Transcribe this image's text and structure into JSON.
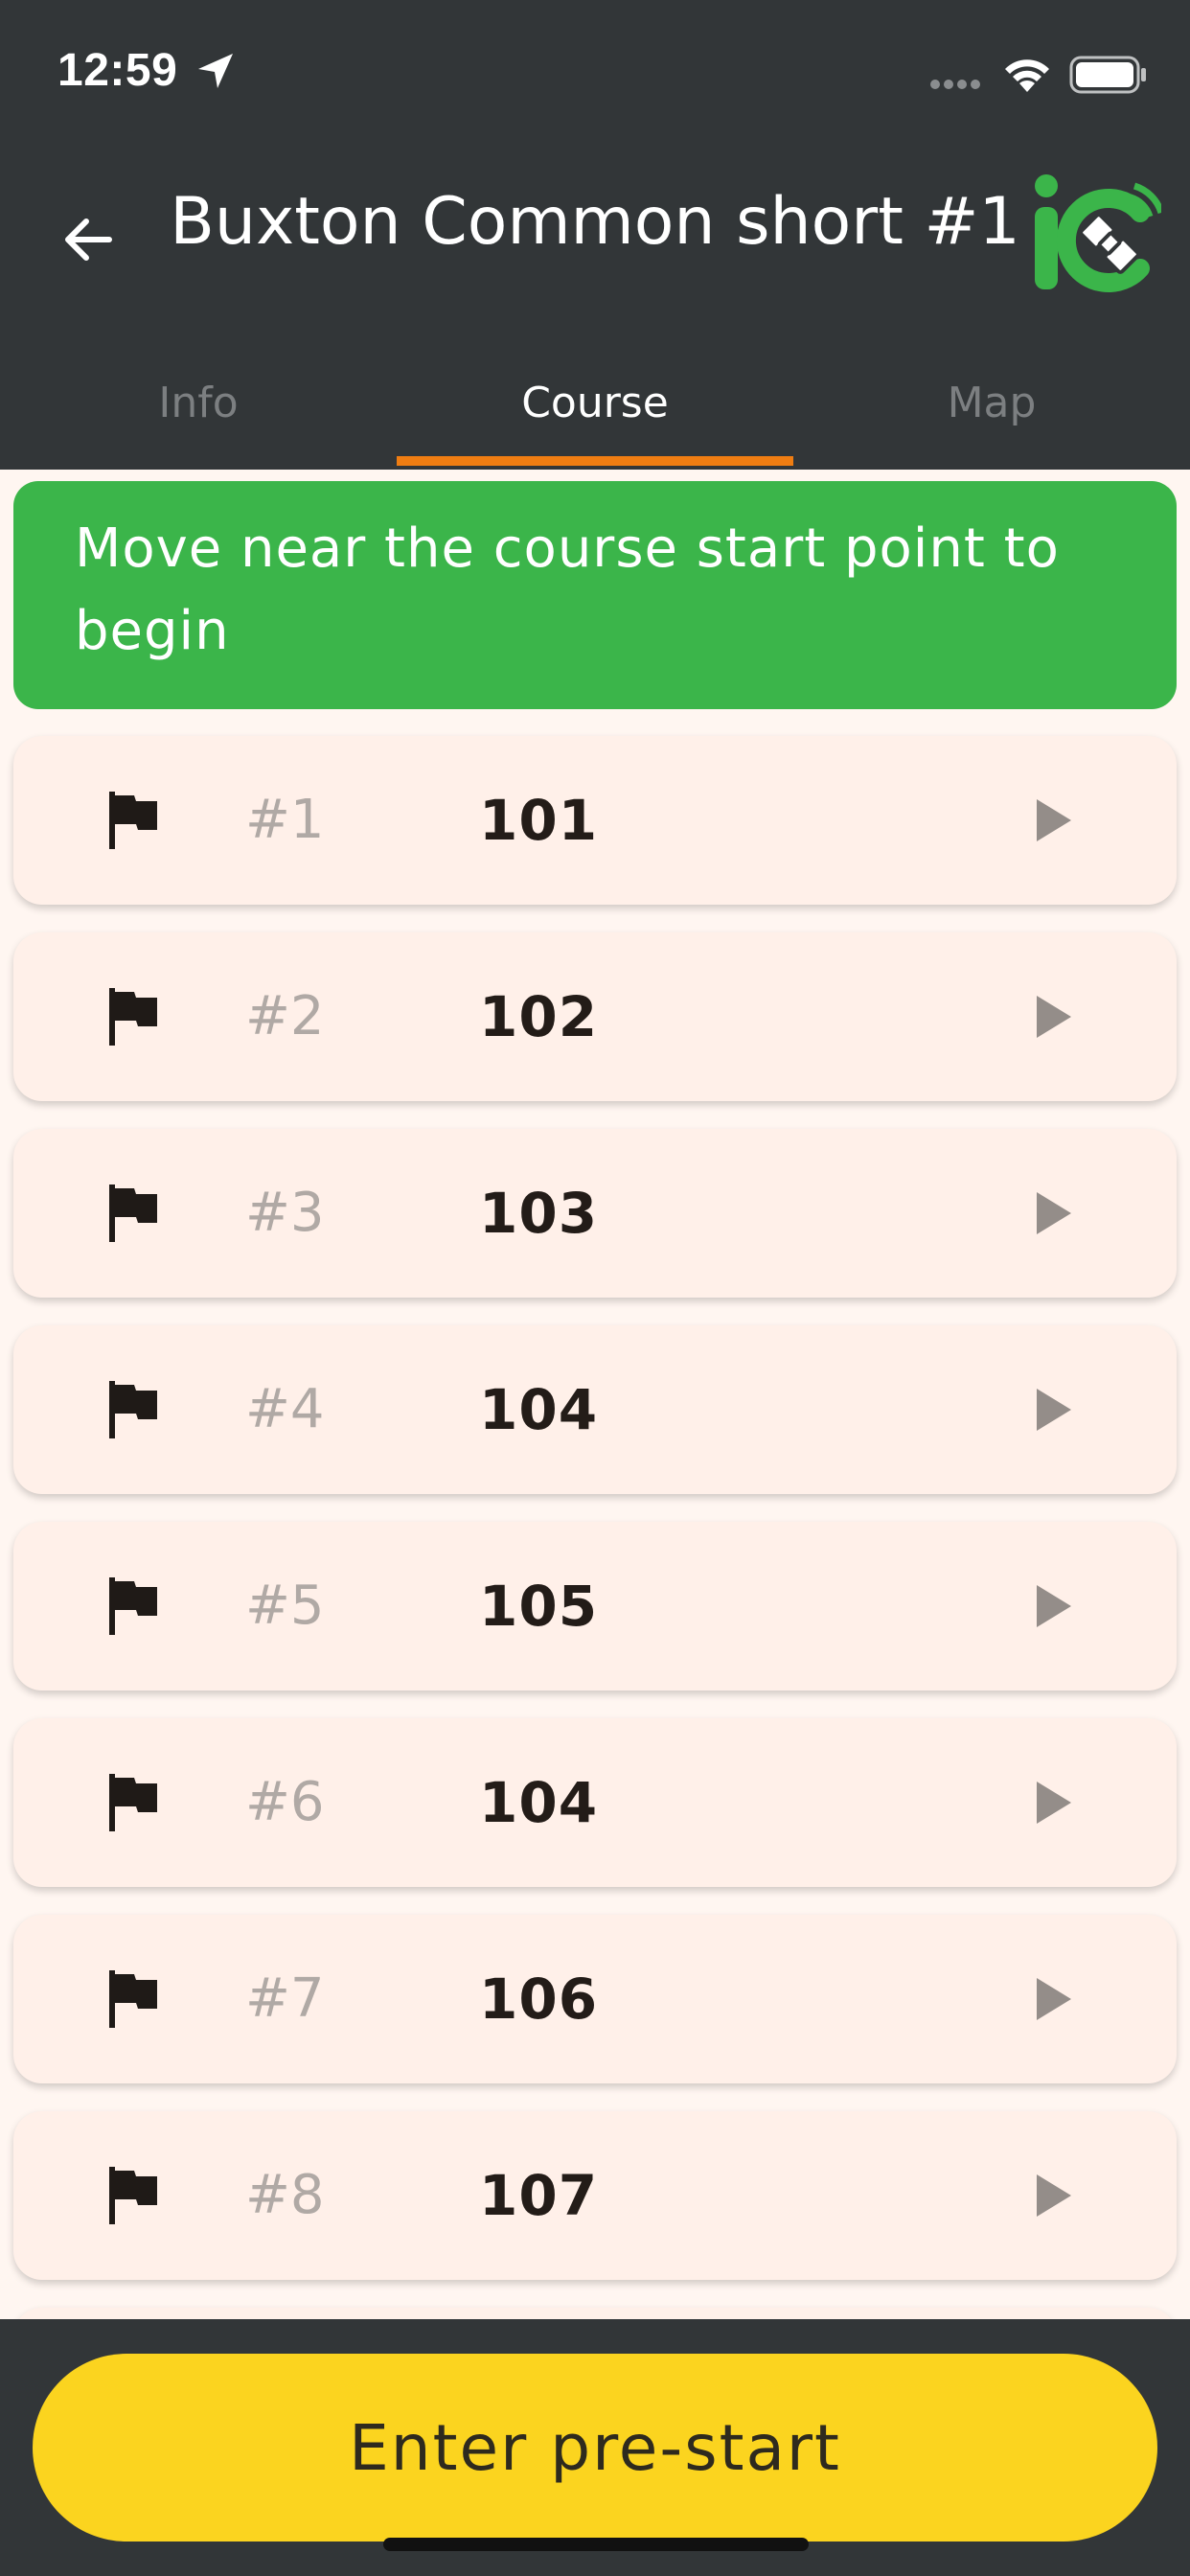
{
  "status_bar": {
    "time": "12:59",
    "icons": [
      "location-arrow-icon",
      "cellular-signal-icon",
      "wifi-icon",
      "battery-icon"
    ]
  },
  "header": {
    "title": "Buxton Common short #1",
    "back_icon": "back-arrow-icon",
    "logo_icon": "ic-satellite-logo"
  },
  "tabs": [
    {
      "label": "Info",
      "active": false
    },
    {
      "label": "Course",
      "active": true
    },
    {
      "label": "Map",
      "active": false
    }
  ],
  "banner": {
    "text": "Move near the course start point to begin",
    "color": "#3bb54a"
  },
  "controls": [
    {
      "number": "#1",
      "code": "101"
    },
    {
      "number": "#2",
      "code": "102"
    },
    {
      "number": "#3",
      "code": "103"
    },
    {
      "number": "#4",
      "code": "104"
    },
    {
      "number": "#5",
      "code": "105"
    },
    {
      "number": "#6",
      "code": "104"
    },
    {
      "number": "#7",
      "code": "106"
    },
    {
      "number": "#8",
      "code": "107"
    }
  ],
  "footer": {
    "button_label": "Enter pre-start",
    "button_color": "#fbd41f"
  },
  "colors": {
    "appbar": "#323638",
    "tab_indicator": "#ef7d12",
    "row_background": "#fff0e9"
  }
}
